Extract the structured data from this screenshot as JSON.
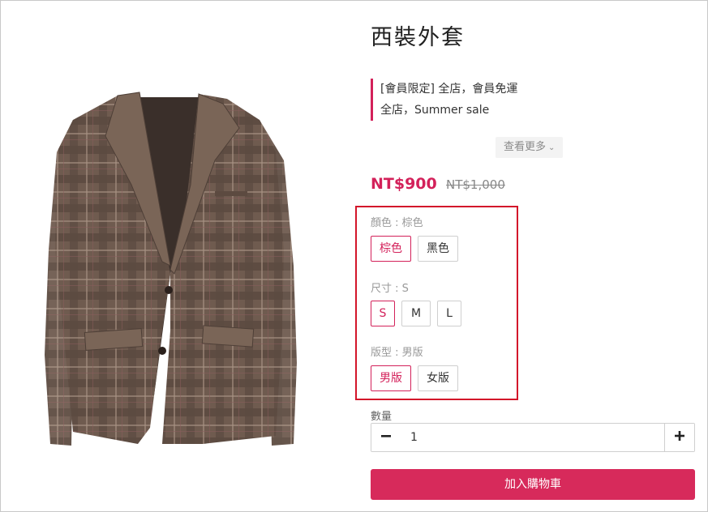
{
  "product": {
    "title": "西裝外套",
    "image_alt": "plaid-brown-blazer"
  },
  "promotions": [
    "[會員限定] 全店，會員免運",
    "全店，Summer sale"
  ],
  "see_more": {
    "label": "查看更多",
    "icon": "chevron-down-icon"
  },
  "price": {
    "current": "NT$900",
    "original": "NT$1,000"
  },
  "options": {
    "color": {
      "label": "顏色 : 棕色",
      "choices": [
        "棕色",
        "黑色"
      ],
      "selected": "棕色"
    },
    "size": {
      "label": "尺寸 : S",
      "choices": [
        "S",
        "M",
        "L"
      ],
      "selected": "S"
    },
    "fit": {
      "label": "版型 : 男版",
      "choices": [
        "男版",
        "女版"
      ],
      "selected": "男版"
    }
  },
  "quantity": {
    "label": "數量",
    "value": "1",
    "minus_icon": "minus-icon",
    "plus_icon": "plus-icon"
  },
  "add_to_cart": {
    "label": "加入購物車"
  },
  "colors": {
    "accent": "#d3215a",
    "button": "#d72a5b",
    "highlight_border": "#d3152a",
    "jacket": "#6e5a4e"
  }
}
